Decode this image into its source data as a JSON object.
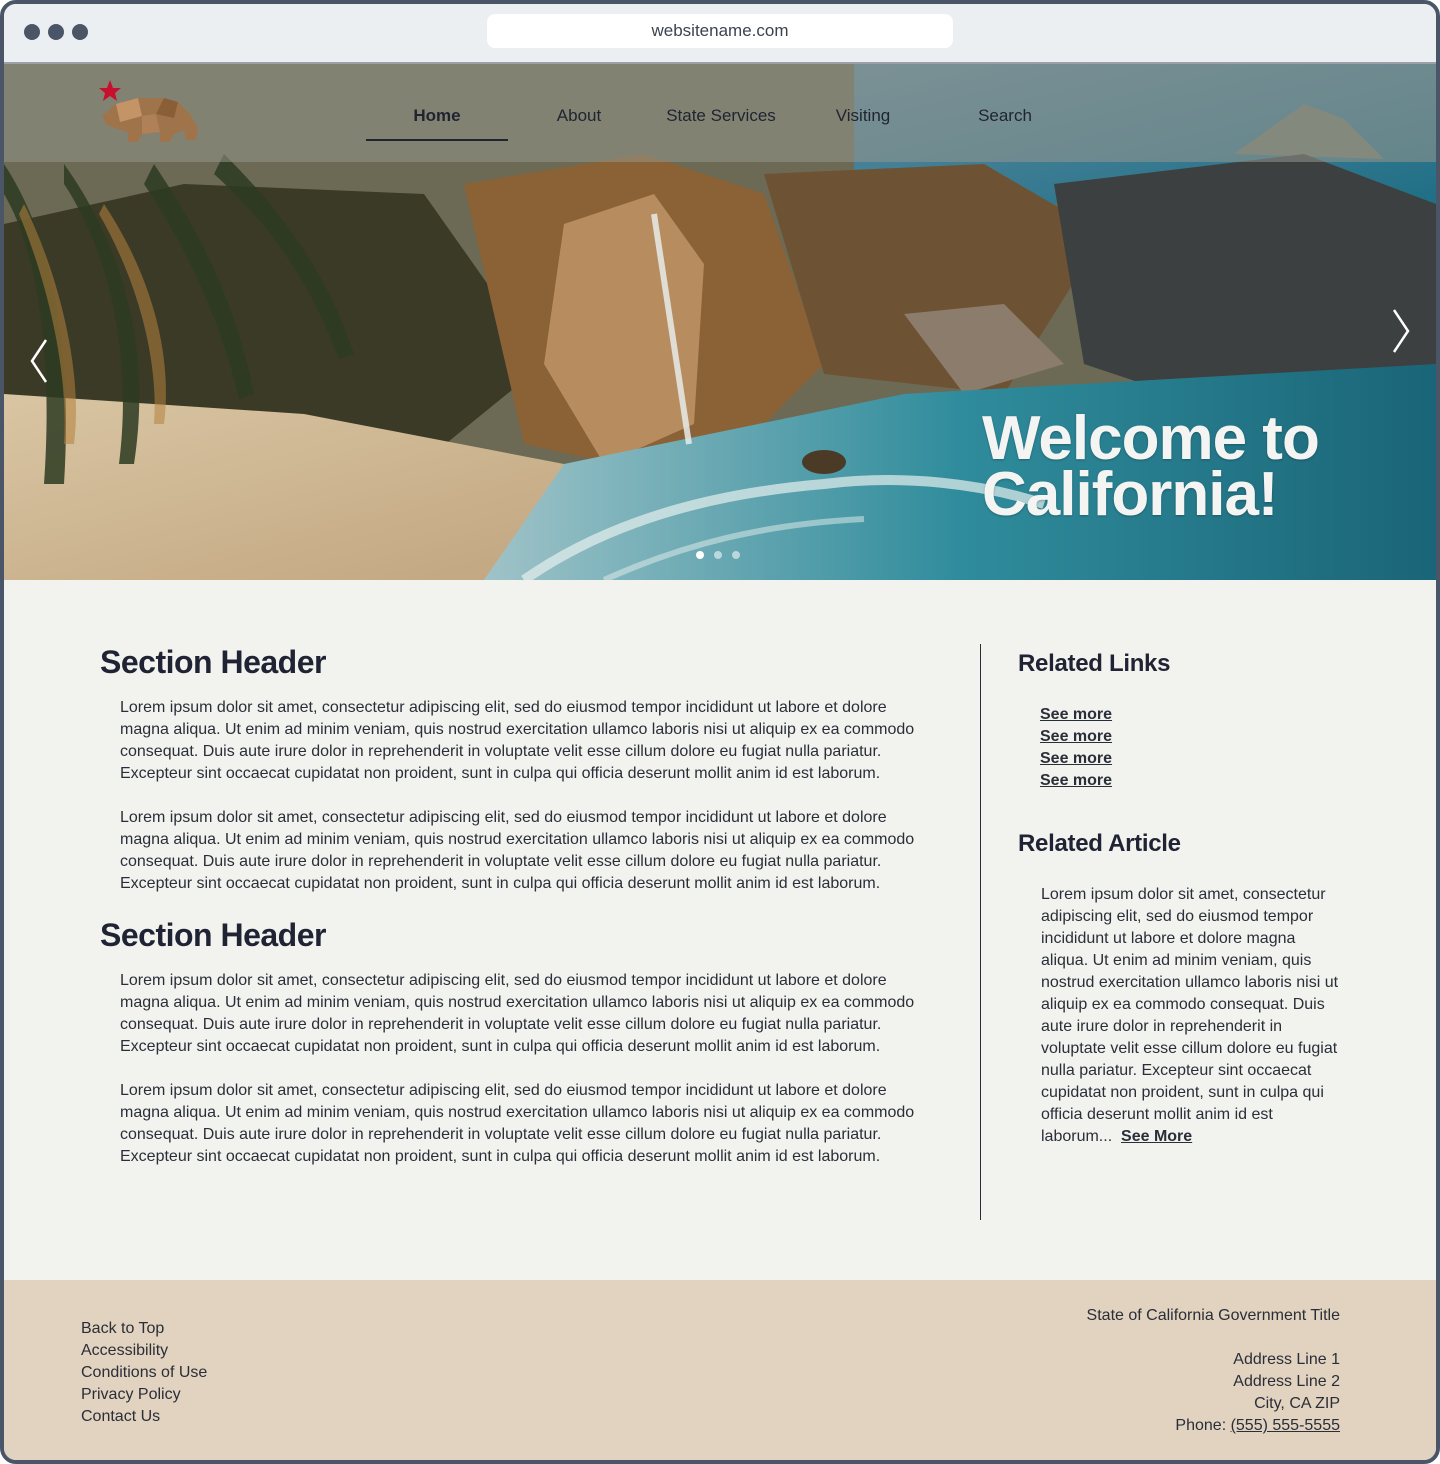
{
  "browser": {
    "url": "websitename.com"
  },
  "nav": {
    "items": [
      {
        "label": "Home"
      },
      {
        "label": "About"
      },
      {
        "label": "State Services"
      },
      {
        "label": "Visiting"
      },
      {
        "label": "Search"
      }
    ],
    "active": "Home"
  },
  "hero": {
    "title_line1": "Welcome to",
    "title_line2": "California!",
    "slide_count": 3,
    "active_slide": 1
  },
  "main": {
    "sections": [
      {
        "header": "Section Header",
        "paragraphs": [
          "Lorem ipsum dolor sit amet, consectetur adipiscing elit, sed do eiusmod tempor incididunt ut labore et dolore magna aliqua. Ut enim ad minim veniam, quis nostrud exercitation ullamco laboris nisi ut aliquip ex ea commodo consequat. Duis aute irure dolor in reprehenderit in voluptate velit esse cillum dolore eu fugiat nulla pariatur. Excepteur sint occaecat cupidatat non proident, sunt in culpa qui officia deserunt mollit anim id est laborum.",
          "Lorem ipsum dolor sit amet, consectetur adipiscing elit, sed do eiusmod tempor incididunt ut labore et dolore magna aliqua. Ut enim ad minim veniam, quis nostrud exercitation ullamco laboris nisi ut aliquip ex ea commodo consequat. Duis aute irure dolor in reprehenderit in voluptate velit esse cillum dolore eu fugiat nulla pariatur. Excepteur sint occaecat cupidatat non proident, sunt in culpa qui officia deserunt mollit anim id est laborum."
        ]
      },
      {
        "header": "Section Header",
        "paragraphs": [
          "Lorem ipsum dolor sit amet, consectetur adipiscing elit, sed do eiusmod tempor incididunt ut labore et dolore magna aliqua. Ut enim ad minim veniam, quis nostrud exercitation ullamco laboris nisi ut aliquip ex ea commodo consequat. Duis aute irure dolor in reprehenderit in voluptate velit esse cillum dolore eu fugiat nulla pariatur. Excepteur sint occaecat cupidatat non proident, sunt in culpa qui officia deserunt mollit anim id est laborum.",
          "Lorem ipsum dolor sit amet, consectetur adipiscing elit, sed do eiusmod tempor incididunt ut labore et dolore magna aliqua. Ut enim ad minim veniam, quis nostrud exercitation ullamco laboris nisi ut aliquip ex ea commodo consequat. Duis aute irure dolor in reprehenderit in voluptate velit esse cillum dolore eu fugiat nulla pariatur. Excepteur sint occaecat cupidatat non proident, sunt in culpa qui officia deserunt mollit anim id est laborum."
        ]
      }
    ]
  },
  "sidebar": {
    "related_links_title": "Related Links",
    "links": [
      "See more",
      "See more",
      "See more",
      "See more"
    ],
    "related_article_title": "Related Article",
    "article_text": "Lorem ipsum dolor sit amet, consectetur adipiscing elit, sed do eiusmod tempor incididunt ut labore et dolore magna aliqua. Ut enim ad minim veniam, quis nostrud exercitation ullamco laboris nisi ut aliquip ex ea commodo consequat. Duis aute irure dolor in reprehenderit in voluptate velit esse cillum dolore eu fugiat nulla pariatur. Excepteur sint occaecat cupidatat non proident, sunt in culpa qui officia deserunt mollit anim id est laborum...",
    "article_more": "See More"
  },
  "footer": {
    "links": [
      "Back to Top",
      "Accessibility",
      "Conditions of Use",
      "Privacy Policy",
      "Contact Us"
    ],
    "org_title": "State of California Government Title",
    "address1": "Address Line 1",
    "address2": "Address Line 2",
    "city": "City, CA ZIP",
    "phone_label": "Phone: ",
    "phone": "(555) 555-5555"
  },
  "colors": {
    "frame": "#4a5568",
    "page_bg": "#f2f3ef",
    "text": "#2a2e38",
    "footer_bg": "#e1d3bf",
    "logo_star": "#c8102e",
    "logo_bear": "#a0744a"
  },
  "icons": [
    "window-dots",
    "bear-logo-icon",
    "star-icon",
    "chevron-left-icon",
    "chevron-right-icon"
  ]
}
